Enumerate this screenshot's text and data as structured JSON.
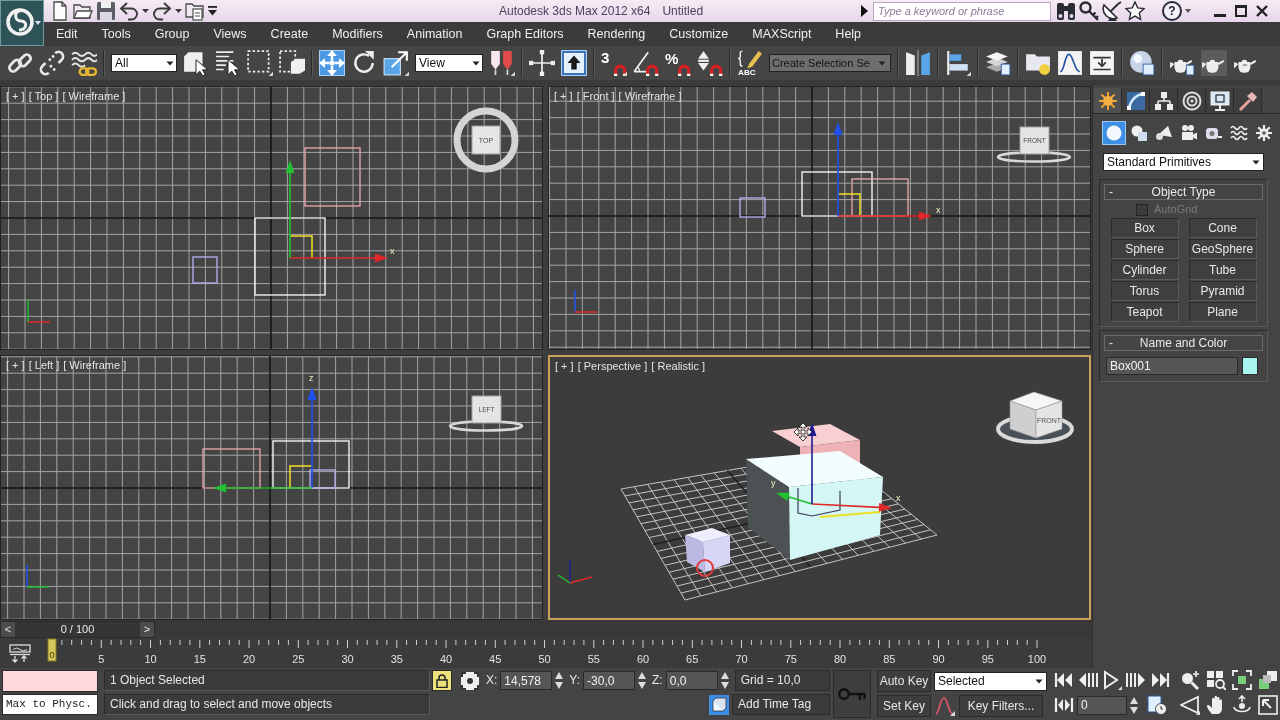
{
  "window": {
    "title": "Autodesk 3ds Max 2012 x64",
    "document": "Untitled",
    "search": {
      "placeholder": "Type a keyword or phrase"
    },
    "help": "?"
  },
  "menu": [
    "Edit",
    "Tools",
    "Group",
    "Views",
    "Create",
    "Modifiers",
    "Animation",
    "Graph Editors",
    "Rendering",
    "Customize",
    "MAXScript",
    "Help"
  ],
  "toolbar": [
    {
      "kind": "icon",
      "selected": false
    },
    {
      "kind": "icon",
      "selected": false
    },
    {
      "kind": "icon",
      "selected": false
    },
    {
      "kind": "separator"
    },
    {
      "kind": "dropdown",
      "value": "All"
    },
    {
      "kind": "icon",
      "selected": false
    },
    {
      "kind": "icon",
      "selected": false
    },
    {
      "kind": "icon",
      "selected": false
    },
    {
      "kind": "icon",
      "selected": false
    },
    {
      "kind": "separator"
    },
    {
      "kind": "icon",
      "selected": true
    },
    {
      "kind": "icon",
      "selected": false
    },
    {
      "kind": "icon",
      "selected": false
    },
    {
      "kind": "dropdown",
      "value": "View"
    },
    {
      "kind": "icon",
      "selected": false
    },
    {
      "kind": "separator"
    },
    {
      "kind": "icon",
      "selected": false
    },
    {
      "kind": "icon",
      "selected": true
    },
    {
      "kind": "separator"
    },
    {
      "kind": "icon",
      "selected": false,
      "label": "3"
    },
    {
      "kind": "icon",
      "selected": false
    },
    {
      "kind": "icon",
      "selected": false,
      "label": "%"
    },
    {
      "kind": "icon",
      "selected": false
    },
    {
      "kind": "separator"
    },
    {
      "kind": "icon",
      "selected": false,
      "label": "ABC"
    },
    {
      "kind": "combo",
      "placeholder": "Create Selection Se"
    },
    {
      "kind": "separator"
    },
    {
      "kind": "icon",
      "selected": false
    },
    {
      "kind": "separator"
    },
    {
      "kind": "icon",
      "selected": false
    },
    {
      "kind": "separator"
    },
    {
      "kind": "icon",
      "selected": false
    },
    {
      "kind": "separator"
    },
    {
      "kind": "icon",
      "selected": false
    },
    {
      "kind": "icon",
      "selected": false
    },
    {
      "kind": "icon",
      "selected": false
    },
    {
      "kind": "separator"
    },
    {
      "kind": "icon",
      "selected": false
    },
    {
      "kind": "separator"
    },
    {
      "kind": "icon",
      "selected": false
    },
    {
      "kind": "icon",
      "selected": false
    },
    {
      "kind": "icon",
      "selected": false
    }
  ],
  "viewports": [
    {
      "labels": [
        "[ + ]",
        "[ Top ]",
        "[ Wireframe ]"
      ],
      "viewcube": "TOP",
      "axes": [
        "x"
      ],
      "active": false
    },
    {
      "labels": [
        "[ + ]",
        "[ Front ]",
        "[ Wireframe ]"
      ],
      "viewcube": "FRONT",
      "axes": [
        "x"
      ],
      "active": false
    },
    {
      "labels": [
        "[ + ]",
        "[ Left ]",
        "[ Wireframe ]"
      ],
      "viewcube": "LEFT",
      "axes": [
        "z"
      ],
      "active": false
    },
    {
      "labels": [
        "[ + ]",
        "[ Perspective ]",
        "[ Realistic ]"
      ],
      "viewcube": "FRONT",
      "axes": [
        "y",
        "x"
      ],
      "active": true
    }
  ],
  "command_panel": {
    "tabs": [
      {
        "selected": true
      },
      {
        "selected": false
      },
      {
        "selected": false
      },
      {
        "selected": false
      },
      {
        "selected": false
      },
      {
        "selected": false
      }
    ],
    "categories": [
      {
        "selected": true
      },
      {
        "selected": false
      },
      {
        "selected": false
      },
      {
        "selected": false
      },
      {
        "selected": false
      },
      {
        "selected": false
      },
      {
        "selected": false
      }
    ],
    "category_dropdown": "Standard Primitives",
    "rollouts": [
      {
        "kind": "buttons",
        "toggle": "-",
        "title": "Object Type",
        "checkbox": {
          "label": "AutoGrid",
          "checked": false,
          "disabled": true
        },
        "buttons": [
          "Box",
          "Cone",
          "Sphere",
          "GeoSphere",
          "Cylinder",
          "Tube",
          "Torus",
          "Pyramid",
          "Teapot",
          "Plane"
        ]
      },
      {
        "kind": "name_color",
        "toggle": "-",
        "title": "Name and Color",
        "value": "Box001",
        "color": "#a8f4f0"
      }
    ]
  },
  "time_slider": {
    "prev": "<",
    "position": "0 / 100",
    "next": ">",
    "level": 0
  },
  "track_bar": {
    "current": "0",
    "labels": [
      "5",
      "10",
      "15",
      "20",
      "25",
      "30",
      "35",
      "40",
      "45",
      "50",
      "55",
      "60",
      "65",
      "70",
      "75",
      "80",
      "85",
      "90",
      "95",
      "100"
    ]
  },
  "status": {
    "listener": "Max to Physc.",
    "selection": "1 Object Selected",
    "prompt": "Click and drag to select and move objects",
    "lock": {
      "on": true
    },
    "coords": [
      {
        "axis": "X:",
        "value": "14,578"
      },
      {
        "axis": "Y:",
        "value": "-30,0"
      },
      {
        "axis": "Z:",
        "value": "0,0"
      }
    ],
    "grid": "Grid = 10,0",
    "time_tag": "Add Time Tag",
    "auto_key": "Auto Key",
    "set_key": "Set Key",
    "key_mode": "Selected",
    "key_filters": "Key Filters...",
    "frame": "0"
  }
}
